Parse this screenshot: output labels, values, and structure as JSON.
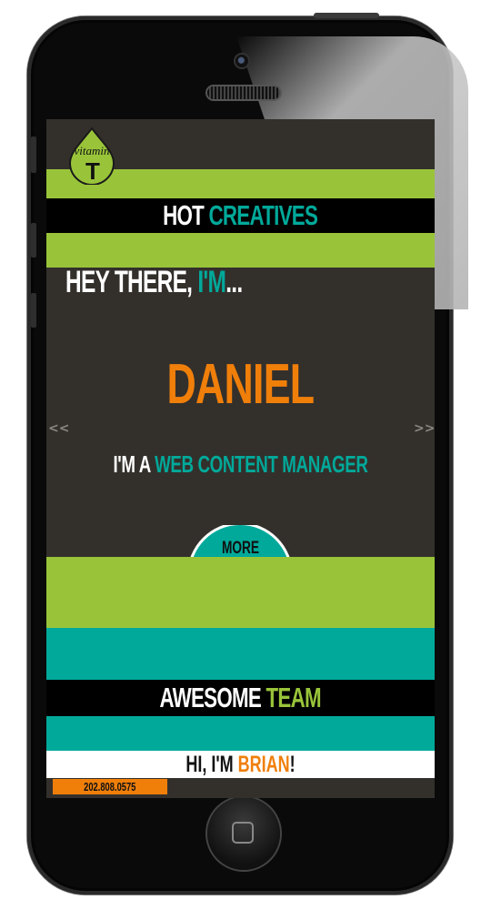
{
  "hero": {
    "logo_text": "vitamin",
    "logo_letter": "T",
    "section_title_white": "HOT ",
    "section_title_accent": "CREATIVES",
    "greeting_white": "HEY THERE, ",
    "greeting_accent": "I'M",
    "greeting_tail": "...",
    "name": "DANIEL",
    "role_prefix": "I'M A ",
    "role": "WEB CONTENT MANAGER",
    "prev_label": "<<",
    "next_label": ">>",
    "more_label": "MORE"
  },
  "team": {
    "title_white": "AWESOME ",
    "title_accent": "TEAM",
    "intro_prefix": "HI, I'M ",
    "intro_name": "BRIAN",
    "intro_suffix": "!",
    "phone": "202.808.0575"
  },
  "colors": {
    "green": "#99c43a",
    "teal": "#00a99a",
    "orange": "#f07f0a",
    "dark": "#33302c",
    "black": "#000000"
  },
  "icons": {
    "logo": "vitamin-t-drop-logo",
    "prev": "double-chevron-left",
    "next": "double-chevron-right",
    "home": "home-button-square"
  }
}
